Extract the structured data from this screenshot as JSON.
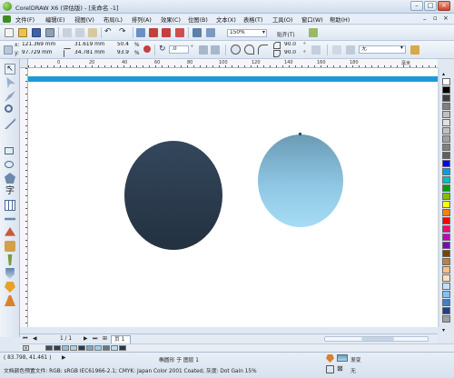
{
  "titlebar": {
    "title": "CorelDRAW X6 (评估版) - [未命名 -1]"
  },
  "menu": {
    "items": [
      "文件(F)",
      "编辑(E)",
      "视图(V)",
      "布局(L)",
      "排列(A)",
      "效果(C)",
      "位图(B)",
      "文本(X)",
      "表格(T)",
      "工具(O)",
      "窗口(W)",
      "帮助(H)"
    ]
  },
  "toolbar": {
    "zoom": "150%",
    "snap": "贴齐(T)"
  },
  "propbar": {
    "x_label": "x:",
    "x": "121.369 mm",
    "y_label": "y:",
    "y": "97.729 mm",
    "w": "31.619 mm",
    "h": "34.781 mm",
    "scale_w": "50.4",
    "scale_h": "93.9",
    "pct": "%",
    "angle": ".0",
    "start_angle": "90.0",
    "end_angle": "90.0",
    "outline": "无",
    "degree": "°"
  },
  "ruler": {
    "h_ticks": [
      "0",
      "20",
      "40",
      "60",
      "80",
      "100",
      "120",
      "140",
      "160",
      "180"
    ],
    "unit": "毫米"
  },
  "pagenav": {
    "counter": "1 / 1",
    "page_tab": "页 1"
  },
  "status": {
    "coords": "( 83.798, 41.461 )",
    "object_info": "椭圆形 于 图层 1",
    "doc_profile": "文档颜色预置文件: RGB: sRGB IEC61966-2.1; CMYK: Japan Color 2001 Coated; 灰度: Dot Gain 15%",
    "fill_label": "渐变",
    "outline_label": "无"
  },
  "colors": {
    "accent": "#1e9ad8",
    "dark_ellipse": "#2a3a4c",
    "gradient_top": "#6a9bb5",
    "gradient_bottom": "#9fd4f0"
  },
  "palette": [
    "#ffffff",
    "#000000",
    "#404040",
    "#808080",
    "#c0c0c0",
    "#e0e0e0",
    "#c0c0c0",
    "#a0a0a0",
    "#808080",
    "#606060",
    "#0000ff",
    "#00a0e0",
    "#00c0c0",
    "#00a000",
    "#80c000",
    "#ffff00",
    "#ff8000",
    "#ff0000",
    "#ff0080",
    "#c000c0",
    "#8000c0",
    "#804000",
    "#c08040",
    "#ffc080",
    "#ffe0c0",
    "#c0e0ff",
    "#80c0ff",
    "#4080c0",
    "#204080",
    "#a0a0a0"
  ],
  "docpalette": [
    "#3c4e64",
    "#304050",
    "#8fc0db",
    "#a6d4ee",
    "#2a3a4c",
    "#7aa8c4",
    "#9ad0ed",
    "#5c7a94",
    "#b8dff2",
    "#27384a"
  ]
}
